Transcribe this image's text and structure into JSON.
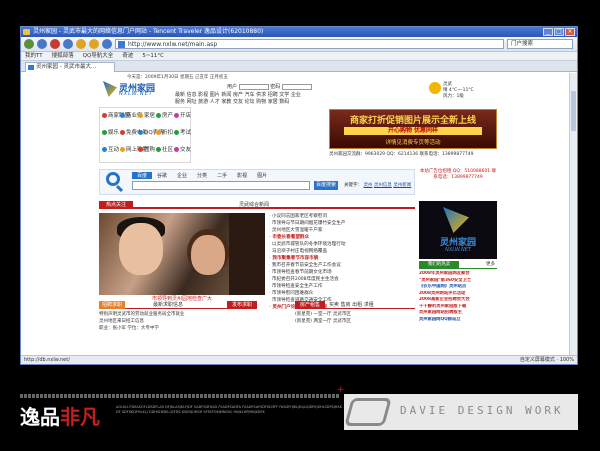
{
  "browser": {
    "title": "灵州家园 - 灵武市最大的网络信息门户网站 - Tencent Traveler 逸品设计(62010880)",
    "address": "http://www.nxlw.net/main.asp",
    "search_placeholder": "门户搜索",
    "favorites": [
      "我的TT",
      "搜狐部落",
      "QQ导航大全",
      "奇迹",
      "5~11°C"
    ],
    "tab_title": "灵州家园 - 灵武市最大...",
    "status_left": "http://db.nxlw.net/",
    "status_right": "自定义屏幕模式 · 100%"
  },
  "site": {
    "logo_cn": "灵州家园",
    "logo_en": "NXLW.NET",
    "date": "今天是：2009年1月30日 星期五 己丑年 正月初五",
    "user_label": "用户",
    "pass_label": "密码",
    "nav1": "最新  信息  影视  图片  新闻  房产  汽车  供求  招聘  文学  企业",
    "nav2": "服务  网址  旅游  人才  家教  交友  论坛  购物  家居  数码",
    "weather_city": "灵武",
    "weather_temp": "晴 4°C~-11°C",
    "weather_wind": "风力：1级"
  },
  "categories": [
    {
      "label": "商家联盟",
      "color": "#d43c2a"
    },
    {
      "label": "商业街",
      "color": "#2a7fd0"
    },
    {
      "label": "家居",
      "color": "#e8a020"
    },
    {
      "label": "房产",
      "color": "#2a9a3a"
    },
    {
      "label": "开店",
      "color": "#c23ca0"
    },
    {
      "label": "娱乐",
      "color": "#2a9a3a"
    },
    {
      "label": "免费电影",
      "color": "#d43c2a"
    },
    {
      "label": "QQ表情",
      "color": "#2a7fd0"
    },
    {
      "label": "折扣",
      "color": "#e8a020"
    },
    {
      "label": "考试",
      "color": "#2a9a3a"
    },
    {
      "label": "互动",
      "color": "#2a7fd0"
    },
    {
      "label": "网上购物",
      "color": "#e8a020"
    },
    {
      "label": "团购",
      "color": "#d43c2a"
    },
    {
      "label": "社区",
      "color": "#2a9a3a"
    },
    {
      "label": "交友",
      "color": "#c23ca0"
    }
  ],
  "banner": {
    "line1": "商家打折促销图片展示全新上线",
    "line2": "开心购物  优惠同样",
    "line3": "详情见消费专页等活动"
  },
  "contact": "灵州家园交流群：9963029  QQ：6214136  联系电话：13899877749",
  "search": {
    "tabs": [
      "百度",
      "谷歌",
      "企业",
      "分类",
      "二手",
      "影视",
      "图片"
    ],
    "button": "百度搜索",
    "keyword_label": "关键字：",
    "keywords": [
      "灵州",
      "灵州信息",
      "灵州新闻"
    ]
  },
  "news_section": {
    "label": "热点关注",
    "title": "灵武综合新闻",
    "photo_caption": "市领导到灵州园地检查广大",
    "items": [
      {
        "text": "小议同志国家老区考察慰问",
        "red": false
      },
      {
        "text": "市领导与节日期间烟花爆竹安全生产",
        "red": false
      },
      {
        "text": "灵州地区大雪温暖千户家",
        "red": false
      },
      {
        "text": "市委长春看望群众",
        "red": true
      },
      {
        "text": "以灵武市城管队的冬季环境治理行动",
        "red": false
      },
      {
        "text": "马沿坝子村庄电视网络覆盖",
        "red": false
      },
      {
        "text": "我市聚集春节市容市貌",
        "red": true
      },
      {
        "text": "我市召开春节前安全生产工作会议",
        "red": false
      },
      {
        "text": "市领导检查春节前期文化市场",
        "red": false
      },
      {
        "text": "市纪委召开2008年度民主生活会",
        "red": false
      },
      {
        "text": "市领导检查安全生产工作",
        "red": false
      },
      {
        "text": "市领导慰问困难群众",
        "red": false
      },
      {
        "text": "市领导检查道路交通安全工作",
        "red": false
      },
      {
        "text": "灵州门户论坛上线帮助市民",
        "red": true
      }
    ]
  },
  "right_panel": {
    "top": "本站广告位招租  QQ：510088601  联系电话：13899877749",
    "logo_cn": "灵州家园",
    "logo_en": "NXLW.NET",
    "bar_label": "我们的热卖",
    "bar_more": "更多",
    "items": [
      {
        "text": "2008年灵州家园网友聚会",
        "cls": "hl"
      },
      {
        "text": "\"灵州家园\"第360安全卫士",
        "cls": "hl"
      },
      {
        "text": "《农乐中国网》灵州站点",
        "cls": "bl"
      },
      {
        "text": "2008灵州网站评比活动",
        "cls": "hl"
      },
      {
        "text": "2008高新企业招聘会大会",
        "cls": "hl"
      },
      {
        "text": "千千静听灵州家园版下载",
        "cls": "hl"
      },
      {
        "text": "灵州家园网站招聘版主",
        "cls": "hl"
      },
      {
        "text": "灵州家园网QQ群成立",
        "cls": "bl"
      }
    ]
  },
  "bottom": {
    "left_label": "招聘求职",
    "left_mid": "最新求职信息",
    "left_right": "发布求职",
    "left_items": [
      "特别声明灵武市的劳动就业服务局全市就业",
      "灵州地区来日招工信息",
      "职业：张小军 学位：大专中学"
    ],
    "mid_label": "房产租售",
    "mid_tabs": "买卖  售房  出租  求租",
    "mid_items": [
      "(新星苑)     一室一厅 灵武市区",
      "(新星苑)     两室一厅 灵武市区"
    ]
  },
  "footer": {
    "logo_a": "逸品",
    "logo_b": "非凡",
    "text": "AOLKLI.FDKASOFLDSDFLAS DFJKLASJKLFJDF SADFSDFASD FSADFSADFA FSADFSAFSDFSD3FF FASDFHJKLJKLJLKJDFKJSHLSDFKJHSKDF SDFSKDFHLKLJ GDHSHEJKL:JSFDS KSKHJUHSH SFFAFOKJMNOKL HKJKLHPJHKJKDFK",
    "plus": "+",
    "davie": "DAVIE DESIGN WORK"
  }
}
